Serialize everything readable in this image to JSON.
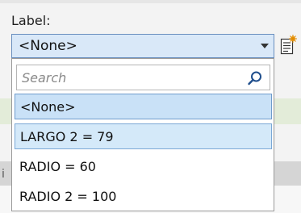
{
  "field": {
    "label": "Label:"
  },
  "combo": {
    "value": "<None>"
  },
  "dropdown": {
    "search_placeholder": "Search",
    "options": [
      {
        "label": "<None>",
        "state": "selected"
      },
      {
        "label": "LARGO 2 = 79",
        "state": "hover"
      },
      {
        "label": "RADIO = 60",
        "state": "normal"
      },
      {
        "label": "RADIO 2 = 100",
        "state": "normal"
      }
    ]
  },
  "background": {
    "edge_fragment": "i"
  },
  "icons": {
    "side": "new-label-icon",
    "search": "search-icon",
    "arrow": "chevron-down-icon"
  },
  "colors": {
    "accent_border": "#6a8fbf",
    "selection": "#c9e1f7",
    "hover": "#d4e9f9"
  }
}
